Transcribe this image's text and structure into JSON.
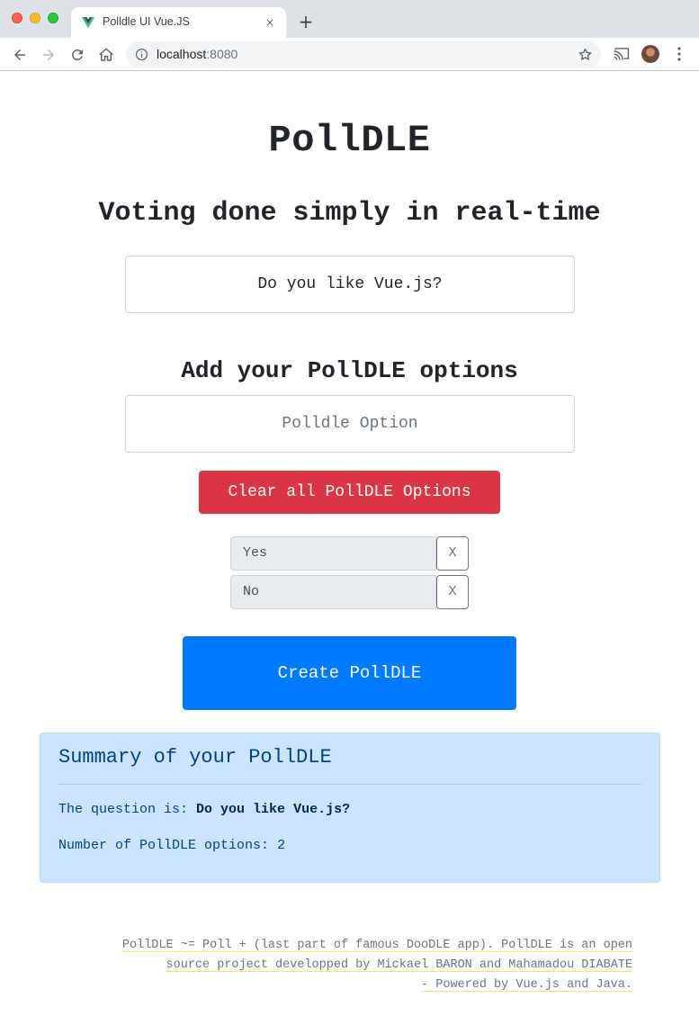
{
  "browser": {
    "tab_title": "Polldle UI Vue.JS",
    "tab_close_glyph": "×",
    "new_tab_glyph": "+",
    "url_host": "localhost",
    "url_port": ":8080",
    "icons": [
      "vue-favicon-icon",
      "back-arrow-icon",
      "forward-arrow-icon",
      "reload-icon",
      "home-icon",
      "info-icon",
      "star-icon",
      "cast-icon",
      "avatar",
      "kebab-menu-icon"
    ]
  },
  "page": {
    "title": "PollDLE",
    "subtitle": "Voting done simply in real-time",
    "question_value": "Do you like Vue.js?",
    "options_heading": "Add your PollDLE options",
    "option_placeholder": "Polldle Option",
    "clear_button": "Clear all PollDLE Options",
    "options": [
      {
        "label": "Yes",
        "remove": "X"
      },
      {
        "label": "No",
        "remove": "X"
      }
    ],
    "create_button": "Create PollDLE"
  },
  "summary": {
    "title": "Summary of your PollDLE",
    "question_prefix": "The question is:",
    "question": "Do you like Vue.js?",
    "options_count_label": "Number of PollDLE options:",
    "options_count": "2"
  },
  "footer": {
    "line1": "PollDLE ~= Poll + (last part of famous DooDLE app). PollDLE is an open",
    "line2": "source project developped by Mickael BARON and Mahamadou DIABATE",
    "line3": "- Powered by Vue.js and Java."
  },
  "colors": {
    "danger": "#dc3545",
    "primary": "#007bff",
    "info_bg": "#cce5ff",
    "info_text": "#004085",
    "vue_green": "#41b883",
    "vue_dark": "#35495e"
  }
}
